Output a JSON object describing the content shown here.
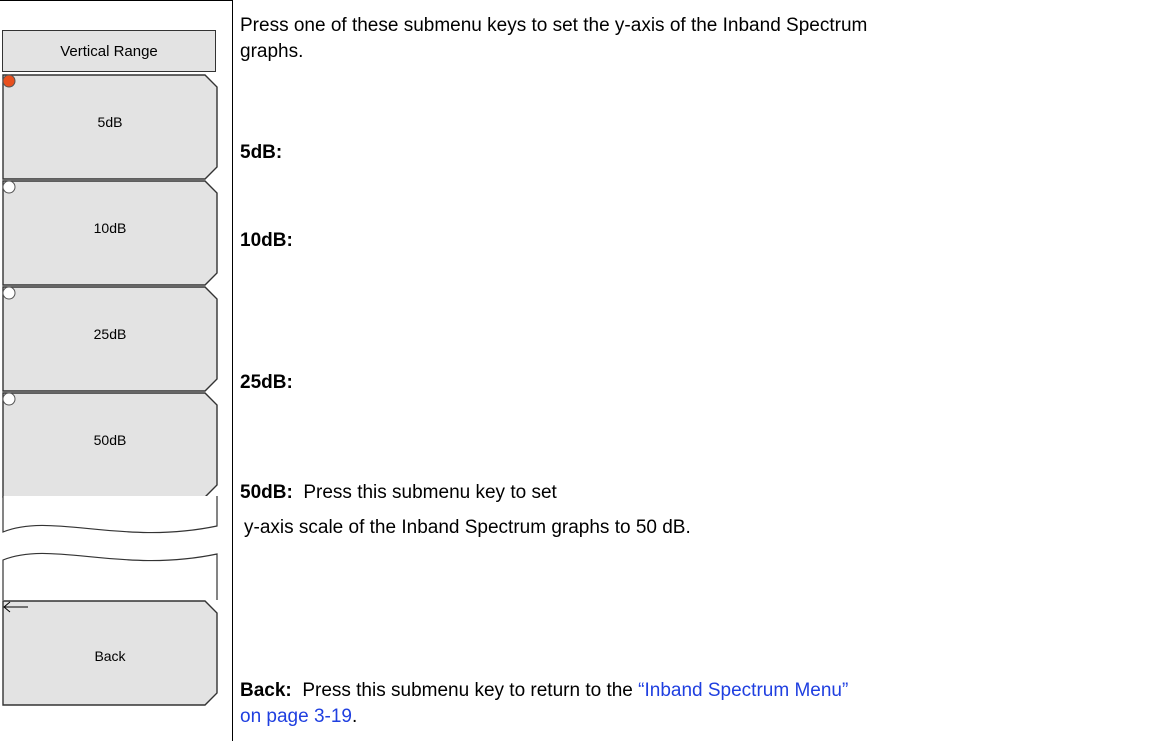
{
  "menu": {
    "title": "Vertical Range",
    "keys": [
      {
        "label": "5dB",
        "selected": true
      },
      {
        "label": "10dB",
        "selected": false
      },
      {
        "label": "25dB",
        "selected": false
      },
      {
        "label": "50dB",
        "selected": false
      }
    ],
    "back_label": "Back",
    "selected_color": "#e8501e"
  },
  "text": {
    "intro_line1": "Press one of these submenu keys to set the y-axis of the Inband Spectrum",
    "intro_line2": "graphs.",
    "item_5db": "5dB:",
    "item_10db": "10dB:",
    "item_25db": "25dB:",
    "item_50db_label": "50dB:",
    "item_50db_desc": "Press this submenu key to set",
    "item_50db_desc2": "y-axis scale of the Inband Spectrum graphs to 50 dB.",
    "back_label": "Back:",
    "back_desc": "Press this submenu key to return to the",
    "back_link_1": "“Inband Spectrum Menu”",
    "back_link_2": "on page 3-19",
    "back_end": "."
  }
}
